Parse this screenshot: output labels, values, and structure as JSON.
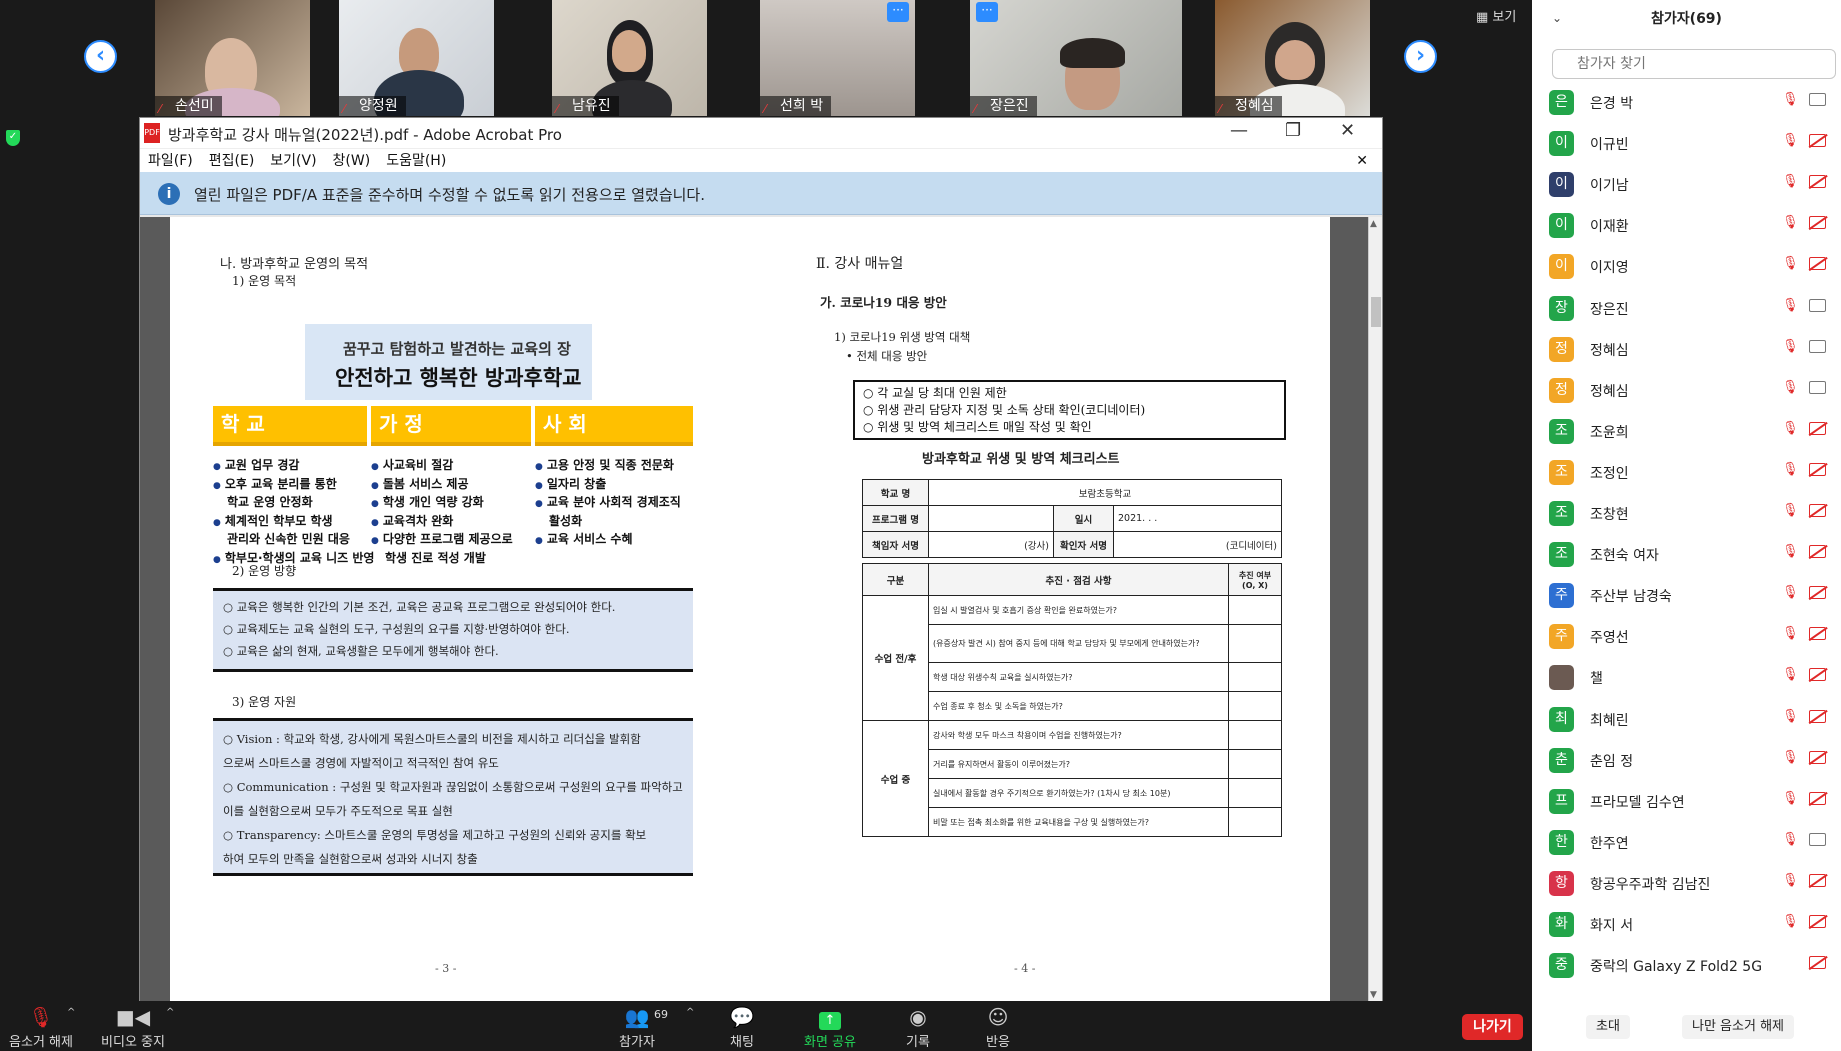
{
  "video_tiles": [
    {
      "name": "손선미",
      "colors": [
        "#6c5a4a",
        "#d8c6ad"
      ],
      "more": false
    },
    {
      "name": "양정원",
      "colors": [
        "#3a4656",
        "#eef0f1"
      ],
      "more": false
    },
    {
      "name": "남유진",
      "colors": [
        "#2b2e33",
        "#d8d2c6"
      ],
      "more": false
    },
    {
      "name": "선희 박",
      "colors": [
        "#a29c97",
        "#dbd6d2"
      ],
      "more": true
    },
    {
      "name": "장은진",
      "colors": [
        "#b9b9b3",
        "#e0dfdb"
      ],
      "more": true
    },
    {
      "name": "정혜심",
      "colors": [
        "#8a5a2f",
        "#eeeeec"
      ],
      "more": false
    }
  ],
  "view_button": "보기",
  "acrobat": {
    "title": "방과후학교 강사 매뉴얼(2022년).pdf - Adobe Acrobat Pro",
    "menu": [
      "파일(F)",
      "편집(E)",
      "보기(V)",
      "창(W)",
      "도움말(H)"
    ],
    "info_message": "열린 파일은 PDF/A 표준을 준수하며 수정할 수 없도록 읽기 전용으로 열렸습니다."
  },
  "doc": {
    "left": {
      "heading": "나. 방과후학교 운영의 목적",
      "sub1": "1) 운영 목적",
      "banner_line1": "꿈꾸고 탐험하고 발견하는 교육의 장",
      "banner_line2": "안전하고 행복한 방과후학교",
      "col_school": "학 교",
      "col_home": "가 정",
      "col_society": "사 회",
      "school_items": [
        "교원 업무 경감",
        "오후 교육 분리를 통한",
        "학교 운영 안정화",
        "체계적인 학부모 학생",
        "관리와 신속한 민원 대응",
        "학부모·학생의 교육 니즈 반영"
      ],
      "home_items": [
        "사교육비 절감",
        "돌봄 서비스 제공",
        "학생 개인 역량 강화",
        "교육격차 완화",
        "다양한 프로그램 제공으로",
        "학생 진로 적성 개발"
      ],
      "society_items": [
        "고용 안정 및 직종 전문화",
        "일자리 창출",
        "교육 분야 사회적 경제조직",
        "활성화",
        "교육 서비스 수혜"
      ],
      "sub2": "2) 운영 방향",
      "direction": [
        "○ 교육은 행복한 인간의 기본 조건, 교육은 공교육 프로그램으로 완성되어야 한다.",
        "○ 교육제도는 교육 실현의 도구, 구성원의 요구를 지향·반영하여야 한다.",
        "○ 교육은 삶의 현재, 교육생활은 모두에게 행복해야 한다."
      ],
      "sub3": "3) 운영 자원",
      "resources": [
        "○ Vision : 학교와 학생, 강사에게 목원스마트스쿨의 비전을 제시하고 리더십을 발휘함",
        "  으로써 스마트스쿨 경영에 자발적이고 적극적인 참여 유도",
        "○ Communication : 구성원 및 학교자원과 끊임없이 소통함으로써 구성원의 요구를 파악하고",
        "  이를 실현함으로써 모두가 주도적으로 목표 실현",
        "○ Transparency: 스마트스쿨 운영의 투명성을 제고하고 구성원의 신뢰와 공지를 확보",
        "  하여 모두의 만족을 실현함으로써 성과와 시너지 창출"
      ],
      "page_num": "- 3 -"
    },
    "right": {
      "heading": "Ⅱ. 강사 매뉴얼",
      "sub_a": "가. 코로나19 대응 방안",
      "sub_1": "1) 코로나19 위생 방역 대책",
      "bullet": "• 전체 대응 방안",
      "box_items": [
        "○ 각 교실 당 최대 인원 제한",
        "○ 위생 관리 담당자 지정 및 소독 상태 확인(코디네이터)",
        "○ 위생 및 방역 체크리스트 매일 작성 및 확인"
      ],
      "table_title": "방과후학교 위생 및 방역 체크리스트",
      "school_label": "학교 명",
      "school_value": "보람초등학교",
      "program_label": "프로그램 명",
      "date_label": "일시",
      "date_value": "2021.   .   .",
      "writer_label": "책임자 서명",
      "writer_note": "(강사)",
      "checker_label": "확인자 서명",
      "checker_note": "(코디네이터)",
      "col_div": "구분",
      "col_item": "추진 · 점검 사항",
      "col_done": "추진 여부 (O, X)",
      "group1": "수업 전/후",
      "group1_items": [
        "입실 시 발열검사 및 호흡기 증상 확인을 완료하였는가?",
        "(유증상자 발견 시) 참여 중지 등에 대해 학교 담당자 및 부모에게 안내하였는가?",
        "학생 대상 위생수칙 교육을 실시하였는가?",
        "수업 종료 후 청소 및 소독을 하였는가?"
      ],
      "group2": "수업 중",
      "group2_items": [
        "강사와 학생 모두 마스크 착용이며 수업을 진행하였는가?",
        "거리를 유지하면서 활동이 이루어졌는가?",
        "실내에서 활동할 경우 주기적으로 환기하였는가? (1차시 당 최소 10분)",
        "비말 또는 접촉 최소화를 위한 교육내용을 구상 및 실행하였는가?"
      ],
      "page_num": "- 4 -"
    }
  },
  "toolbar": {
    "unmute": "음소거 해제",
    "video_stop": "비디오 중지",
    "participants": "참가자",
    "participants_count": "69",
    "chat": "채팅",
    "share": "화면 공유",
    "record": "기록",
    "reactions": "반응",
    "leave": "나가기"
  },
  "panel": {
    "title": "참가자(69)",
    "search_placeholder": "참가자 찾기",
    "participants": [
      {
        "initial": "은",
        "name": "은경 박",
        "color": "#23a54a",
        "cam": true
      },
      {
        "initial": "이",
        "name": "이규빈",
        "color": "#23a54a",
        "cam": false
      },
      {
        "initial": "이",
        "name": "이기남",
        "color": "#2f3f6b",
        "cam": false
      },
      {
        "initial": "이",
        "name": "이재환",
        "color": "#23a54a",
        "cam": false
      },
      {
        "initial": "이",
        "name": "이지영",
        "color": "#f2a626",
        "cam": false
      },
      {
        "initial": "장",
        "name": "장은진",
        "color": "#23a54a",
        "cam": true
      },
      {
        "initial": "정",
        "name": "정혜심",
        "color": "#f2a626",
        "cam": true
      },
      {
        "initial": "정",
        "name": "정혜심",
        "color": "#f2a626",
        "cam": true
      },
      {
        "initial": "조",
        "name": "조윤희",
        "color": "#23a54a",
        "cam": false
      },
      {
        "initial": "조",
        "name": "조정인",
        "color": "#f2a626",
        "cam": false
      },
      {
        "initial": "조",
        "name": "조창현",
        "color": "#23a54a",
        "cam": false
      },
      {
        "initial": "조",
        "name": "조현숙 여자",
        "color": "#23a54a",
        "cam": false
      },
      {
        "initial": "주",
        "name": "주산부 남경숙",
        "color": "#2d6fd2",
        "cam": false
      },
      {
        "initial": "주",
        "name": "주영선",
        "color": "#f2a626",
        "cam": false
      },
      {
        "initial": "",
        "name": "챌",
        "color": "#6b5a52",
        "cam": false
      },
      {
        "initial": "최",
        "name": "최혜린",
        "color": "#23a54a",
        "cam": false
      },
      {
        "initial": "춘",
        "name": "춘임 정",
        "color": "#23a54a",
        "cam": false
      },
      {
        "initial": "프",
        "name": "프라모델 김수연",
        "color": "#23a54a",
        "cam": false
      },
      {
        "initial": "한",
        "name": "한주연",
        "color": "#23a54a",
        "cam": true
      },
      {
        "initial": "항",
        "name": "항공우주과학 김남진",
        "color": "#d8334a",
        "cam": false
      },
      {
        "initial": "화",
        "name": "화지 서",
        "color": "#23a54a",
        "cam": false
      },
      {
        "initial": "중",
        "name": "중락의 Galaxy Z Fold2 5G",
        "color": "#23a54a",
        "cam": false,
        "no_mic": true
      }
    ],
    "invite": "초대",
    "unmute_me": "나만 음소거 해제"
  }
}
